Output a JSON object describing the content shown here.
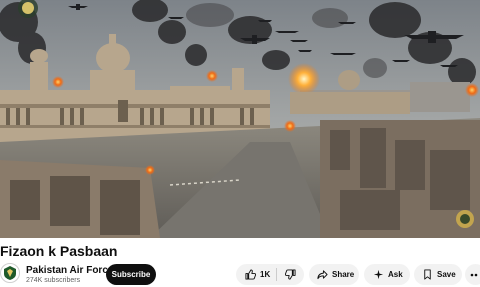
{
  "video": {
    "title": "Fizaon k Pasbaan"
  },
  "channel": {
    "name": "Pakistan Air Force",
    "subscribers": "274K subscribers"
  },
  "actions": {
    "subscribe_label": "Subscribe",
    "like_count": "1K",
    "share_label": "Share",
    "ask_label": "Ask",
    "save_label": "Save"
  },
  "icons": {
    "like": "thumbs-up-icon",
    "dislike": "thumbs-down-icon",
    "share": "share-arrow-icon",
    "ask": "sparkle-icon",
    "save": "bookmark-icon",
    "more": "more-dots-icon",
    "channel_logo": "air-force-crest-icon"
  },
  "colors": {
    "subscribe_bg": "#0f0f0f",
    "pill_bg": "#f2f2f2"
  }
}
